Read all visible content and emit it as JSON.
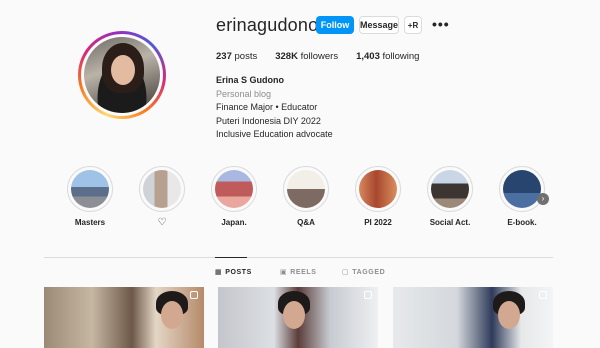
{
  "profile": {
    "username": "erinagudono",
    "follow_label": "Follow",
    "message_label": "Message",
    "suggest_label": "+R",
    "more_label": "•••",
    "stats": {
      "posts_count": "237",
      "posts_label": "posts",
      "followers_count": "328K",
      "followers_label": "followers",
      "following_count": "1,403",
      "following_label": "following"
    },
    "bio": {
      "name": "Erina S Gudono",
      "category": "Personal blog",
      "lines": [
        "Finance Major • Educator",
        "Puteri Indonesia DIY 2022",
        "Inclusive Education advocate"
      ]
    }
  },
  "highlights": [
    {
      "label": "Masters"
    },
    {
      "label": "♡"
    },
    {
      "label": "Japan."
    },
    {
      "label": "Q&A"
    },
    {
      "label": "PI 2022"
    },
    {
      "label": "Social Act."
    },
    {
      "label": "E-book."
    }
  ],
  "highlights_next_icon": "chevron-right-icon",
  "tabs": [
    {
      "label": "POSTS",
      "icon": "grid-icon",
      "active": true
    },
    {
      "label": "REELS",
      "icon": "reels-icon",
      "active": false
    },
    {
      "label": "TAGGED",
      "icon": "tag-icon",
      "active": false
    }
  ],
  "posts": [
    {
      "type": "carousel"
    },
    {
      "type": "reel"
    },
    {
      "type": "reel"
    }
  ],
  "colors": {
    "accent": "#0095f6",
    "background": "#fafafa",
    "text": "#262626",
    "muted": "#8e8e8e"
  }
}
